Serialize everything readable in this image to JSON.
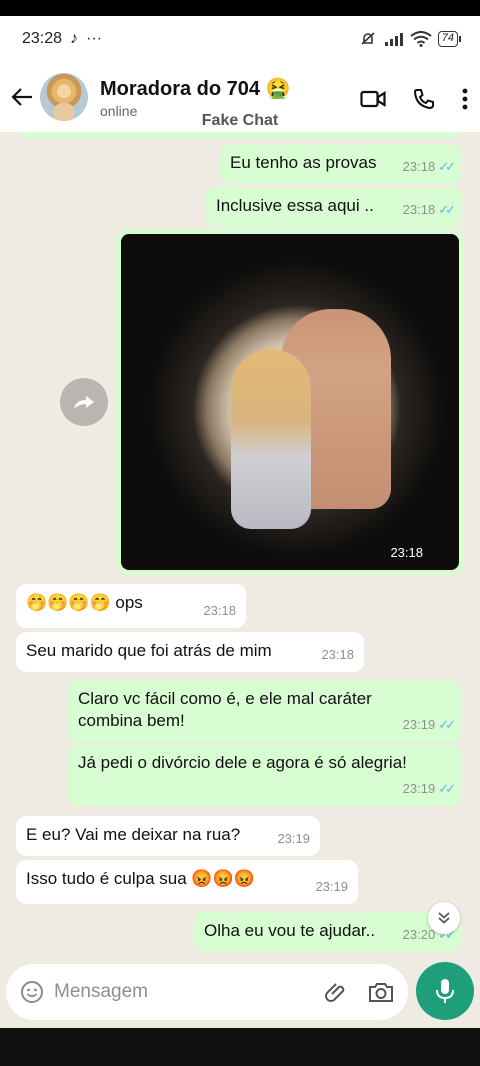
{
  "status_bar": {
    "time": "23:28",
    "tiktok_glyph": "♪",
    "dots": "···",
    "battery": "74"
  },
  "header": {
    "contact_name": "Moradora do 704 🤮",
    "contact_status": "online",
    "overlay_label": "Fake Chat"
  },
  "messages": [
    {
      "text": "Eu tenho as provas",
      "time": "23:18"
    },
    {
      "text": "Inclusive essa aqui ..",
      "time": "23:18"
    },
    {
      "image_time": "23:18"
    },
    {
      "text": "🤭🤭🤭🤭 ops",
      "time": "23:18"
    },
    {
      "text": "Seu marido que foi atrás de mim",
      "time": "23:18"
    },
    {
      "text": "Claro vc fácil como é, e ele mal caráter combina bem!",
      "time": "23:19"
    },
    {
      "text": "Já pedi o divórcio dele e agora é só alegria!",
      "time": "23:19"
    },
    {
      "text": "E eu? Vai me deixar na rua?",
      "time": "23:19"
    },
    {
      "text": "Isso tudo é culpa sua 😡😡😡",
      "time": "23:19"
    },
    {
      "text": "Olha eu vou te ajudar..",
      "time": "23:20"
    }
  ],
  "input": {
    "placeholder": "Mensagem"
  },
  "colors": {
    "outgoing": "#d9fdd3",
    "incoming": "#ffffff",
    "chat_bg": "#efeae2",
    "mic": "#1e9e7a",
    "ticks": "#53bdeb"
  }
}
